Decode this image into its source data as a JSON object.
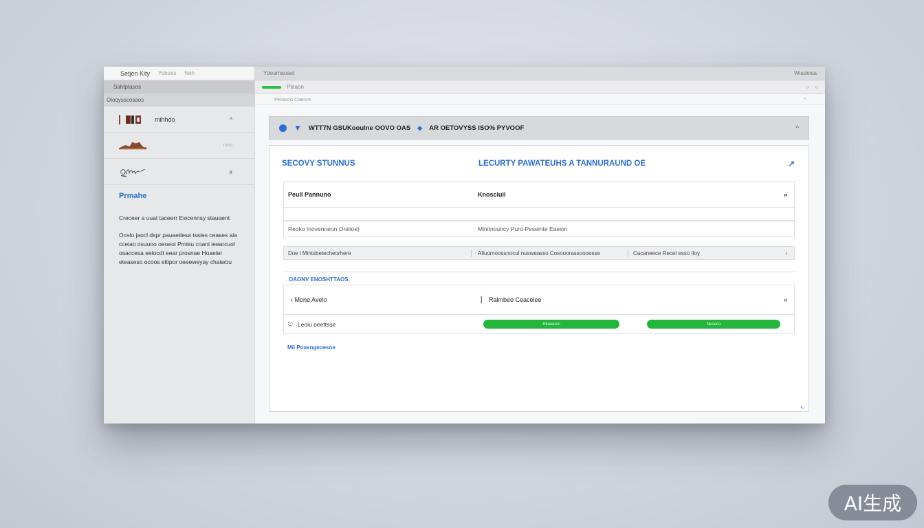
{
  "sidebar": {
    "top_title": "Setjen Kity",
    "top_sub": "Yoboes",
    "top_sub2": "Noh",
    "section1": "Sahtptasos",
    "section2": "Oioqysscosaos",
    "items": [
      {
        "label": "mihhdo",
        "chevron": "^"
      },
      {
        "label": "",
        "chevron": "nmo"
      },
      {
        "label": "",
        "chevron": "x"
      }
    ],
    "link": "Prmahe",
    "text1": "Creceer a uuat taceerr Ewcennsy stauaent",
    "text2": "Ocelo jaocl dspr pauaetlesa tssies ceases aia cceiao osuuoo oeoeoi Pmtsu coani ieearcuol osaccesa eelocdt eear prosnae Hoaeler eteaseso ocoos eltipor oeeeweyay chaiwou"
  },
  "main": {
    "window_title": "Ydeamaoaet",
    "window_right": "Wiadeisa",
    "address_text": "Pleaon",
    "crumbs_left": "Peiasoo Caesre",
    "crumbs_right": "^",
    "banner_text": "WTT7N GSUKooulne OOVO OAS",
    "banner_text2": "AR OETOVYSS ISO% PYVOOF",
    "banner_right": "^",
    "card": {
      "title_left": "SECOVY STUNNUS",
      "title_mid": "LECURTY PAWATEUHS  A TANNURAUND OE",
      "title_icon": "↗",
      "row_a_left": "Peull Pannuno",
      "row_a_mid": "Knoscluil",
      "row_a_end": "»",
      "row_c_left": "Reoko Inovenneon Orelioe)",
      "row_c_mid": "Minitnouncy  Puro-Peseinte  Eaeion",
      "row_d_1": "Doe l Mintsbetecheorhere",
      "row_d_2": "Alluomoossnocul nusweasso  Cosooorassoooesse",
      "row_d_3": "Cacaneece  Recel   esso  Iloy",
      "row_d_end": "‹",
      "section_title": "OAONV ENOSHTTAOS,",
      "row_e_left": "Mone Avelo",
      "row_e_mid": "Ralmbeo Ceacelee",
      "row_e_end": "»",
      "row_f_left": "Leoiu oeettsse",
      "pill1": "Hlueaosn",
      "pill2": "Nesaco",
      "footer_link": "Mii Poasngeoesoe"
    }
  },
  "badge": "AI生成"
}
